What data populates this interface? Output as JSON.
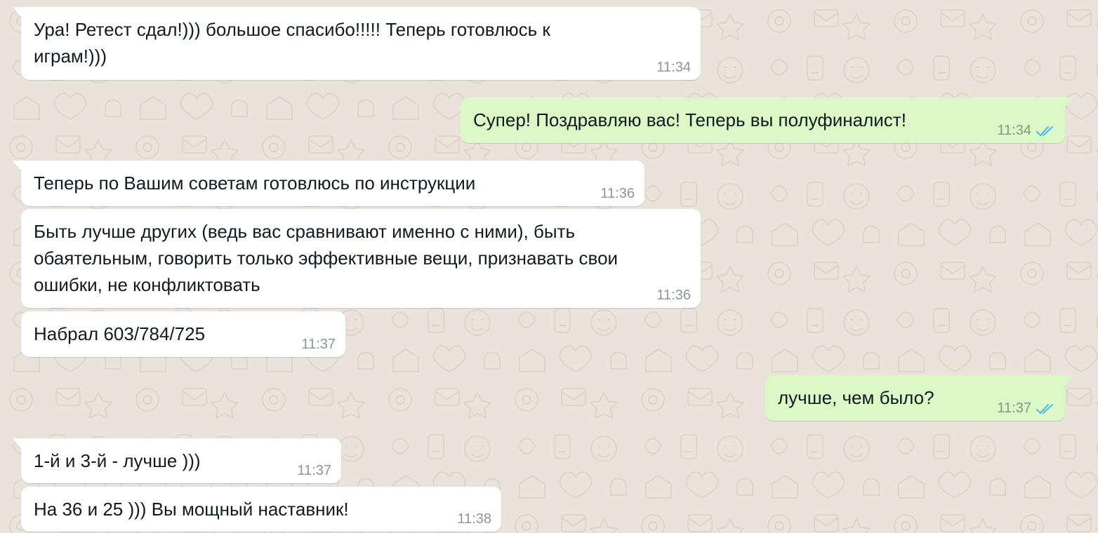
{
  "colors": {
    "background": "#e9e3dc",
    "incoming_bubble": "#ffffff",
    "outgoing_bubble": "#dcf8c6",
    "read_ticks": "#53bdeb",
    "timestamp": "#8f959a"
  },
  "icons": {
    "read_receipt": "double-check-icon"
  },
  "messages": [
    {
      "direction": "in",
      "text": "Ура! Ретест сдал!))) большое спасибо!!!!! Теперь готовлюсь к\nиграм!)))",
      "time": "11:34"
    },
    {
      "direction": "out",
      "text": "Супер! Поздравляю вас! Теперь вы полуфиналист!",
      "time": "11:34",
      "status": "read"
    },
    {
      "direction": "in",
      "text": "Теперь по Вашим советам готовлюсь по инструкции",
      "time": "11:36"
    },
    {
      "direction": "in",
      "text": "Быть лучше других (ведь вас сравнивают именно с ними), быть\nобаятельным, говорить только эффективные вещи, признавать свои\nошибки, не конфликтовать",
      "time": "11:36"
    },
    {
      "direction": "in",
      "text": "Набрал 603/784/725",
      "time": "11:37"
    },
    {
      "direction": "out",
      "text": "лучше, чем было?",
      "time": "11:37",
      "status": "read"
    },
    {
      "direction": "in",
      "text": "1-й и 3-й - лучше )))",
      "time": "11:37"
    },
    {
      "direction": "in",
      "text": "На 36 и 25 ))) Вы мощный наставник!",
      "time": "11:38"
    }
  ]
}
